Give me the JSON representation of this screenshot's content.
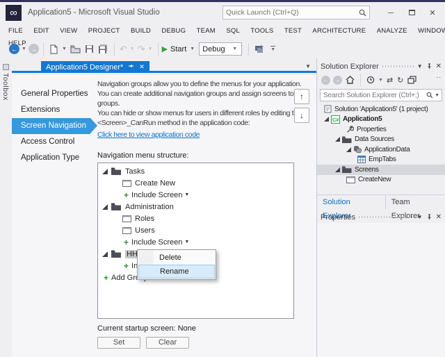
{
  "titlebar": {
    "title": "Application5 - Microsoft Visual Studio",
    "quick_launch_placeholder": "Quick Launch (Ctrl+Q)"
  },
  "menubar": {
    "row1": [
      "FILE",
      "EDIT",
      "VIEW",
      "PROJECT",
      "BUILD",
      "DEBUG",
      "TEAM",
      "SQL",
      "TOOLS",
      "TEST",
      "ARCHITECTURE",
      "ANALYZE",
      "WINDOW"
    ],
    "row2": [
      "HELP"
    ]
  },
  "toolbar": {
    "start_label": "Start",
    "debug_combo_value": "Debug"
  },
  "left_rail": {
    "toolbox_tab_label": "Toolbox"
  },
  "designer": {
    "tab_title": "Application5 Designer*",
    "nav_items": [
      "General Properties",
      "Extensions",
      "Screen Navigation",
      "Access Control",
      "Application Type"
    ],
    "selected_nav": "Screen Navigation",
    "description_lines": [
      "Navigation groups allow you to define the menus for your application.",
      "You can create additional navigation groups and assign screens to",
      "groups.",
      "You can hide or show menus for users in different roles by editing the",
      "<Screen>_CanRun method in the application code:"
    ],
    "link_text": "Click here to view application code",
    "structure_label": "Navigation menu structure:",
    "tree": {
      "group1": "Tasks",
      "group1_screen1": "Create New",
      "include_label": "Include Screen",
      "group2": "Administration",
      "group2_screen1": "Roles",
      "group2_screen2": "Users",
      "group3": "HHH",
      "add_group_label": "Add Group"
    },
    "context_menu": {
      "items": [
        "Delete",
        "Rename"
      ],
      "highlighted": "Rename"
    },
    "startup": {
      "label": "Current startup screen:",
      "value": "None",
      "set_button": "Set",
      "clear_button": "Clear"
    }
  },
  "solution_explorer": {
    "title": "Solution Explorer",
    "overflow_glyph": "..",
    "search_placeholder": "Search Solution Explorer (Ctrl+;)",
    "nodes": {
      "solution": "Solution 'Application5' (1 project)",
      "project": "Application5",
      "properties": "Properties",
      "data_sources": "Data Sources",
      "application_data": "ApplicationData",
      "emp_tabs": "EmpTabs",
      "screens": "Screens",
      "create_new": "CreateNew"
    },
    "bottom_tabs": [
      "Solution Explorer",
      "Team Explorer"
    ]
  },
  "properties_panel": {
    "title": "Properties"
  },
  "colors": {
    "active_tab_blue": "#1278D2",
    "nav_selected_blue": "#3599DB",
    "link_blue": "#1072C6",
    "start_green": "#3D9E3D",
    "selection_gray": "#C6C6C6",
    "menu_highlight_blue": "#D9EBF9",
    "chrome_gray": "#EFEFF2"
  }
}
